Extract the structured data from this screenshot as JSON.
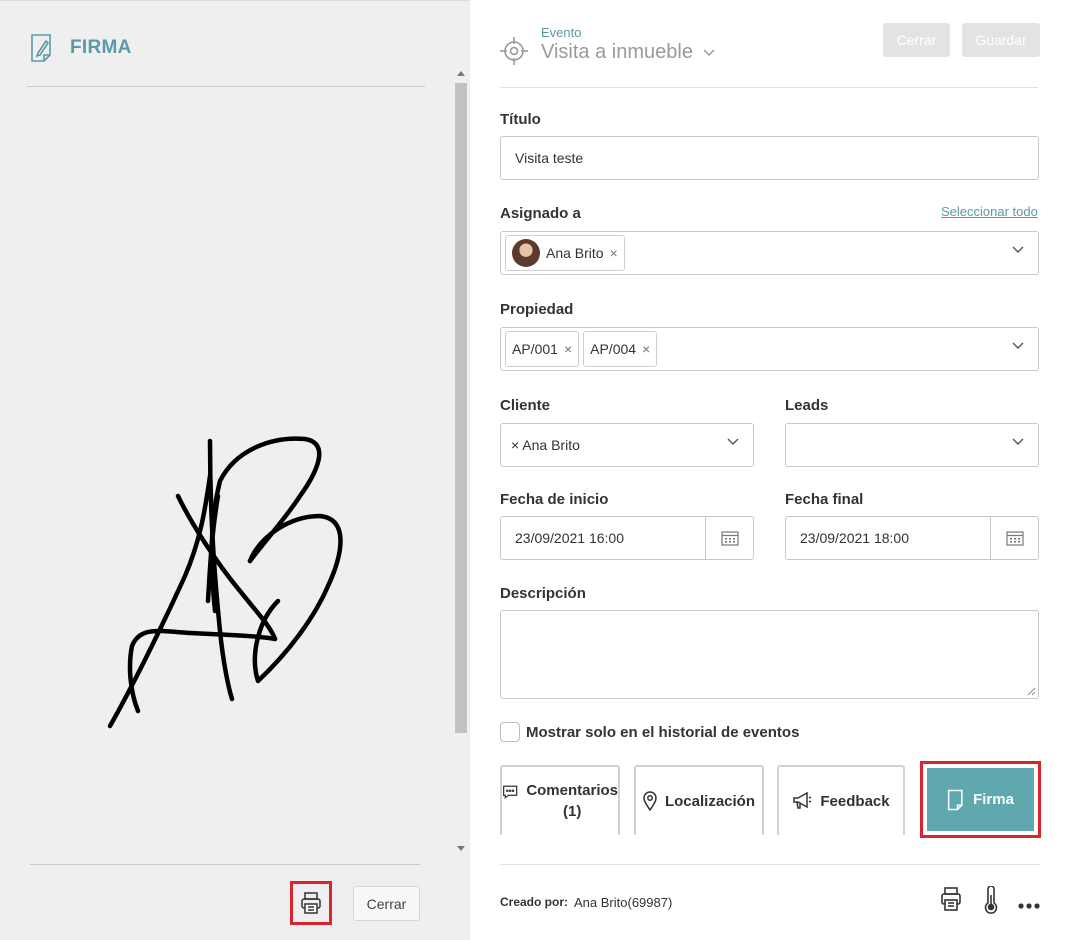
{
  "left": {
    "title": "FIRMA",
    "close_label": "Cerrar"
  },
  "event": {
    "label": "Evento",
    "type": "Visita a inmueble"
  },
  "header_buttons": {
    "close": "Cerrar",
    "save": "Guardar"
  },
  "form": {
    "title_label": "Título",
    "title_value": "Visita teste",
    "assigned_label": "Asignado a",
    "select_all": "Seleccionar todo",
    "assigned_tag": "Ana Brito",
    "property_label": "Propiedad",
    "property_tags": [
      "AP/001",
      "AP/004"
    ],
    "client_label": "Cliente",
    "client_value": "× Ana Brito",
    "leads_label": "Leads",
    "start_label": "Fecha de inicio",
    "start_value": "23/09/2021 16:00",
    "end_label": "Fecha final",
    "end_value": "23/09/2021 18:00",
    "desc_label": "Descripción",
    "history_checkbox": "Mostrar solo en el historial de eventos"
  },
  "tabs": {
    "comments_line1": "Comentarios",
    "comments_line2": "(1)",
    "location": "Localización",
    "feedback": "Feedback",
    "signature": "Firma"
  },
  "footer": {
    "created_by_label": "Creado por:",
    "created_by_value": "Ana Brito(69987)"
  },
  "colors": {
    "accent": "#5ea8ae",
    "highlight": "#d9252e"
  }
}
